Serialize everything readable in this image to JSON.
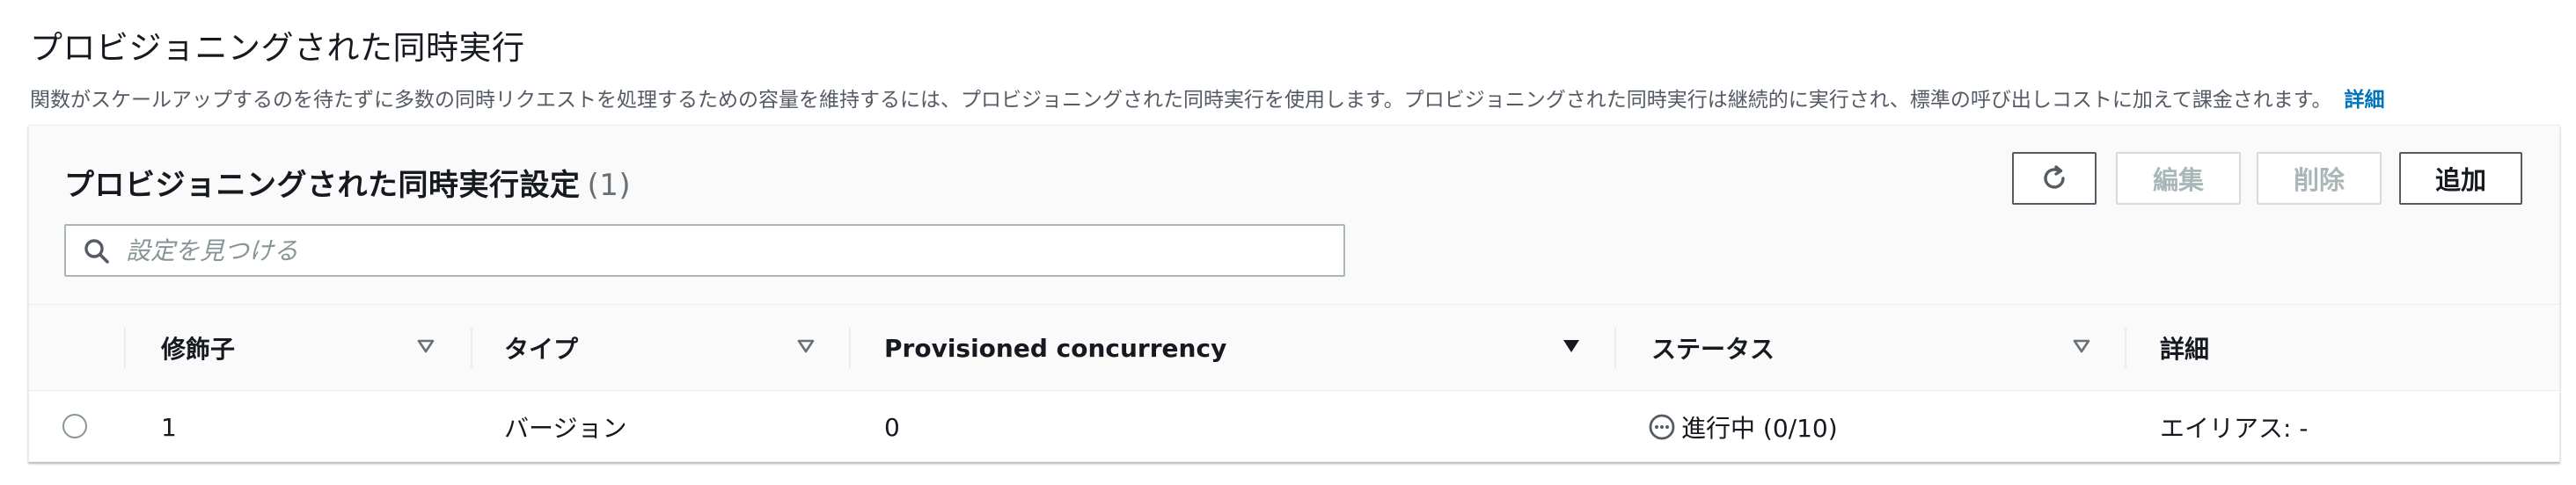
{
  "section": {
    "title": "プロビジョニングされた同時実行",
    "description": "関数がスケールアップするのを待たずに多数の同時リクエストを処理するための容量を維持するには、プロビジョニングされた同時実行を使用します。プロビジョニングされた同時実行は継続的に実行され、標準の呼び出しコストに加えて課金されます。",
    "info_link": "詳細"
  },
  "panel": {
    "title": "プロビジョニングされた同時実行設定",
    "count": "(1)",
    "buttons": {
      "refresh_icon": "refresh-icon",
      "edit": "編集",
      "delete": "削除",
      "add": "追加"
    },
    "search": {
      "placeholder": "設定を見つける",
      "value": ""
    }
  },
  "table": {
    "columns": [
      {
        "label": "修飾子",
        "sort": "sortable"
      },
      {
        "label": "タイプ",
        "sort": "sortable"
      },
      {
        "label": "Provisioned concurrency",
        "sort": "sorted-desc"
      },
      {
        "label": "ステータス",
        "sort": "sortable"
      },
      {
        "label": "詳細",
        "sort": "none"
      }
    ],
    "rows": [
      {
        "selected": false,
        "qualifier": "1",
        "type": "バージョン",
        "provisioned_concurrency": "0",
        "status_icon": "in-progress-icon",
        "status": "進行中 (0/10)",
        "details": "エイリアス: -"
      }
    ]
  },
  "colors": {
    "link": "#0073bb",
    "text": "#16191f",
    "muted": "#545b64",
    "disabled": "#aab7b8",
    "border": "#eaeded"
  }
}
